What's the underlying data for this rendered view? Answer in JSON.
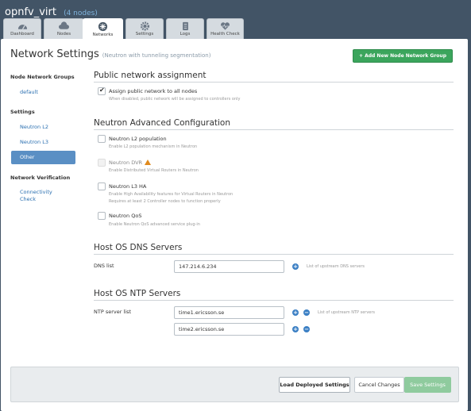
{
  "env": {
    "name": "opnfv_virt",
    "nodes": "(4 nodes)"
  },
  "tabs": [
    {
      "label": "Dashboard",
      "icon": "dashboard-icon"
    },
    {
      "label": "Nodes",
      "icon": "cloud-icon"
    },
    {
      "label": "Networks",
      "icon": "network-icon"
    },
    {
      "label": "Settings",
      "icon": "gear-icon"
    },
    {
      "label": "Logs",
      "icon": "logs-icon"
    },
    {
      "label": "Health Check",
      "icon": "heart-icon"
    }
  ],
  "header": {
    "title": "Network Settings",
    "subtitle": "(Neutron with tunneling segmentation)",
    "add_button": "Add New Node Network Group"
  },
  "sidebar": {
    "groups_heading": "Node Network Groups",
    "groups": [
      "default"
    ],
    "settings_heading": "Settings",
    "settings_items": [
      "Neutron L2",
      "Neutron L3",
      "Other"
    ],
    "verification_heading": "Network Verification",
    "verification_items": [
      "Connectivity Check"
    ]
  },
  "public": {
    "title": "Public network assignment",
    "option_label": "Assign public network to all nodes",
    "option_desc": "When disabled, public network will be assigned to controllers only",
    "checked": true
  },
  "neutron": {
    "title": "Neutron Advanced Configuration",
    "options": [
      {
        "label": "Neutron L2 population",
        "desc": "Enable L2 population mechanism in Neutron"
      },
      {
        "label": "Neutron DVR",
        "desc": "Enable Distributed Virtual Routers in Neutron"
      },
      {
        "label": "Neutron L3 HA",
        "desc": "Enable High Availability features for Virtual Routers in Neutron",
        "desc2": "Requires at least 2 Controller nodes to function properly"
      },
      {
        "label": "Neutron QoS",
        "desc": "Enable Neutron QoS advanced service plug-in"
      }
    ]
  },
  "dns": {
    "title": "Host OS DNS Servers",
    "label": "DNS list",
    "value": "147.214.6.234",
    "hint": "List of upstream DNS servers"
  },
  "ntp": {
    "title": "Host OS NTP Servers",
    "label": "NTP server list",
    "values": [
      "time1.ericsson.se",
      "time2.ericsson.se"
    ],
    "hint": "List of upstream NTP servers"
  },
  "footer": {
    "load": "Load Deployed Settings",
    "cancel": "Cancel Changes",
    "save": "Save Settings"
  },
  "colors": {
    "accent": "#3ba55c",
    "link": "#2a6fb0",
    "active": "#5a8fc4",
    "background": "#425466"
  }
}
